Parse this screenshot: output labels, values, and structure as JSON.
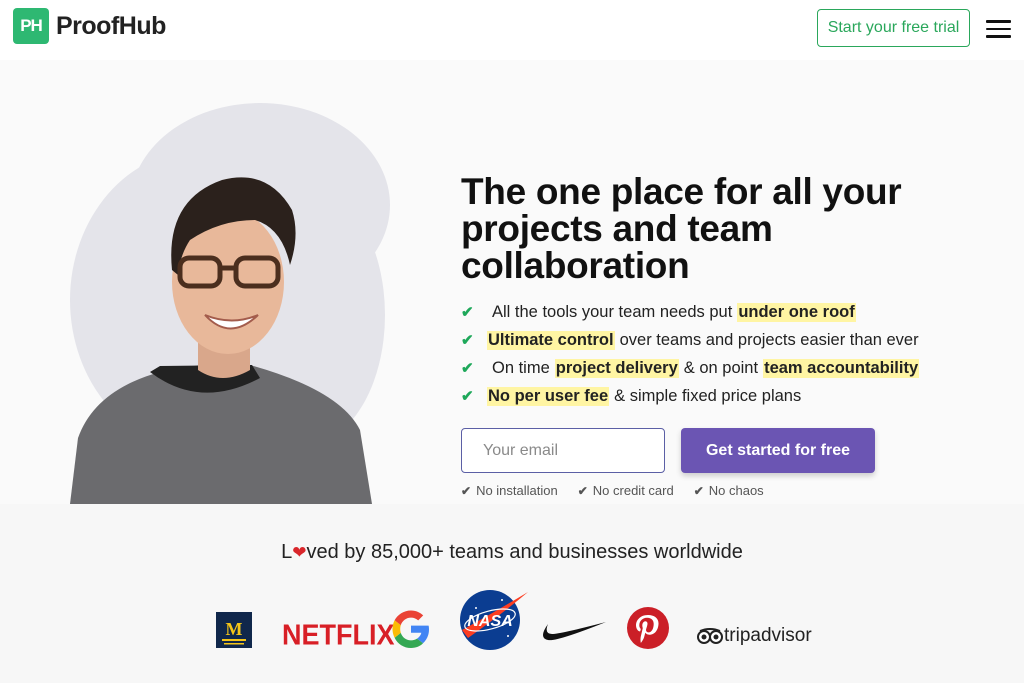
{
  "header": {
    "logo_mark": "PH",
    "logo_text": "ProofHub",
    "trial_button": "Start your free trial"
  },
  "hero": {
    "headline": "The one place for all your projects and team collaboration",
    "features": [
      {
        "parts": [
          "All the tools your team needs put",
          "under one roof"
        ]
      },
      {
        "parts": [
          "Ultimate control",
          "over teams and projects easier than ever"
        ]
      },
      {
        "parts": [
          "On time",
          "project delivery",
          "& on point",
          "team accountability"
        ]
      },
      {
        "parts": [
          "No per user fee",
          "& simple fixed price plans"
        ]
      }
    ],
    "email_placeholder": "Your email",
    "cta_button": "Get started for free",
    "notes": [
      "No installation",
      "No credit card",
      "No chaos"
    ]
  },
  "loved": {
    "prefix": "L",
    "suffix": "ved by 85,000+ teams and businesses worldwide"
  },
  "logos": {
    "michigan": "M",
    "netflix": "NETFLIX",
    "nasa": "NASA",
    "tripadvisor": "tripadvisor"
  },
  "colors": {
    "brand_green": "#2eb872",
    "cta_purple": "#6b55b3",
    "highlight_yellow": "#fff5a3",
    "check_green": "#1ea85a"
  },
  "icons": [
    "check-icon",
    "heart-icon",
    "hamburger-menu-icon"
  ]
}
